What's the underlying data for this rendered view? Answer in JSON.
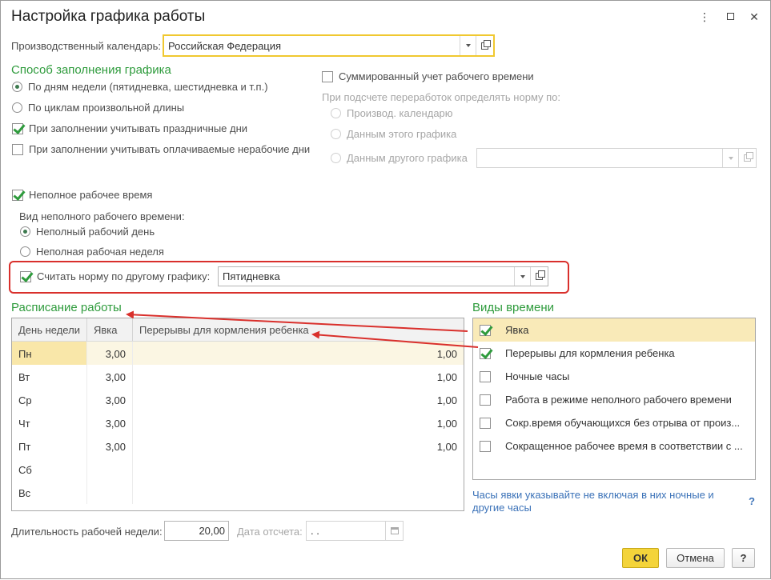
{
  "window": {
    "title": "Настройка графика работы",
    "controls": {
      "menu": "⋮",
      "maximize": "□",
      "close": "✕"
    }
  },
  "calendar": {
    "label": "Производственный календарь:",
    "value": "Российская Федерация"
  },
  "fill_method": {
    "heading": "Способ заполнения графика",
    "by_weekdays": "По дням недели (пятидневка, шестидневка и т.п.)",
    "by_cycles": "По циклам произвольной длины",
    "consider_holidays": "При заполнении учитывать праздничные дни",
    "consider_paid_days_off": "При заполнении учитывать оплачиваемые нерабочие дни"
  },
  "summed": {
    "label": "Суммированный учет рабочего времени",
    "norm_caption": "При подсчете переработок определять норму по:",
    "option_calendar": "Производ. календарю",
    "option_this": "Данным этого графика",
    "option_other": "Данным другого графика"
  },
  "part_time": {
    "label": "Неполное рабочее время",
    "type_caption": "Вид неполного рабочего времени:",
    "day": "Неполный рабочий день",
    "week": "Неполная рабочая неделя",
    "norm_label": "Считать норму по другому графику:",
    "norm_value": "Пятидневка"
  },
  "schedule": {
    "heading": "Расписание работы",
    "columns": [
      "День недели",
      "Явка",
      "Перерывы для кормления ребенка"
    ],
    "rows": [
      {
        "day": "Пн",
        "yavka": "3,00",
        "breaks": "1,00"
      },
      {
        "day": "Вт",
        "yavka": "3,00",
        "breaks": "1,00"
      },
      {
        "day": "Ср",
        "yavka": "3,00",
        "breaks": "1,00"
      },
      {
        "day": "Чт",
        "yavka": "3,00",
        "breaks": "1,00"
      },
      {
        "day": "Пт",
        "yavka": "3,00",
        "breaks": "1,00"
      },
      {
        "day": "Сб",
        "yavka": "",
        "breaks": ""
      },
      {
        "day": "Вс",
        "yavka": "",
        "breaks": ""
      }
    ]
  },
  "time_types": {
    "heading": "Виды времени",
    "items": [
      {
        "label": "Явка",
        "checked": true
      },
      {
        "label": "Перерывы для кормления ребенка",
        "checked": true
      },
      {
        "label": "Ночные часы",
        "checked": false
      },
      {
        "label": "Работа в режиме неполного рабочего времени",
        "checked": false
      },
      {
        "label": "Сокр.время обучающихся без отрыва от произ...",
        "checked": false
      },
      {
        "label": "Сокращенное рабочее время в соответствии с ...",
        "checked": false
      }
    ],
    "hint": "Часы явки указывайте не включая в них ночные и другие часы",
    "help": "?"
  },
  "footer": {
    "week_length_label": "Длительность рабочей недели:",
    "week_length_value": "20,00",
    "ref_date_label": "Дата отсчета:",
    "ref_date_value": " .  .",
    "ok": "ОК",
    "cancel": "Отмена",
    "help": "?"
  },
  "colors": {
    "accent_green": "#2e9b3c",
    "highlight_red": "#d9302c",
    "ok_yellow": "#f4d43a",
    "selected_row": "#f9eab8"
  }
}
